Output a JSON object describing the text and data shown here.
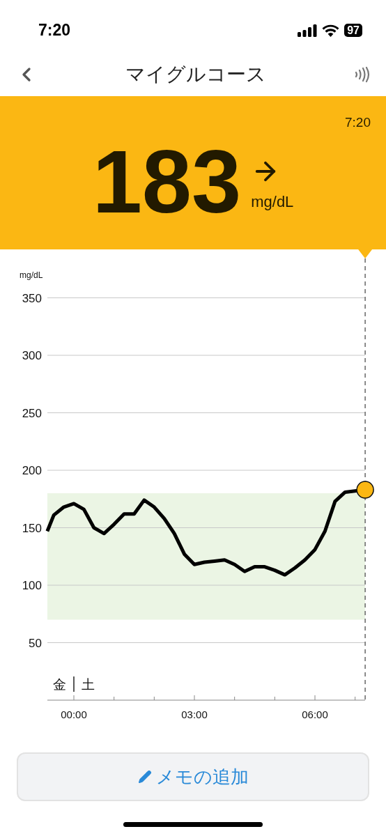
{
  "status_bar": {
    "time": "7:20",
    "battery": "97"
  },
  "nav": {
    "title": "マイグルコース"
  },
  "reading": {
    "time": "7:20",
    "value": "183",
    "unit": "mg/dL"
  },
  "chart": {
    "day_labels": [
      "金",
      "土"
    ],
    "chart_data": {
      "type": "line",
      "ylabel": "mg/dL",
      "grid": true,
      "xlim": [
        -0.66,
        7.25
      ],
      "ylim": [
        0,
        350
      ],
      "yticks": [
        50,
        100,
        150,
        200,
        250,
        300,
        350
      ],
      "xticks": [
        {
          "value": 0,
          "label": "00:00"
        },
        {
          "value": 3,
          "label": "03:00"
        },
        {
          "value": 6,
          "label": "06:00"
        }
      ],
      "x": [
        -0.66,
        -0.5,
        -0.25,
        0,
        0.25,
        0.5,
        0.75,
        1,
        1.25,
        1.5,
        1.75,
        2,
        2.25,
        2.5,
        2.75,
        3,
        3.25,
        3.5,
        3.75,
        4,
        4.25,
        4.5,
        4.75,
        5,
        5.25,
        5.5,
        5.75,
        6,
        6.25,
        6.5,
        6.75,
        7,
        7.25
      ],
      "series": [
        {
          "color": "#000000",
          "values": [
            147,
            161,
            168,
            171,
            166,
            150,
            145,
            153,
            162,
            162,
            174,
            168,
            158,
            145,
            127,
            118,
            120,
            121,
            122,
            118,
            112,
            116,
            116,
            113,
            109,
            115,
            122,
            131,
            147,
            173,
            181,
            182,
            183
          ]
        }
      ],
      "bands": [
        {
          "axis": "y",
          "from": 70,
          "to": 180,
          "color": "#ebf5e4"
        }
      ]
    }
  },
  "memo_button": {
    "label": "メモの追加"
  }
}
